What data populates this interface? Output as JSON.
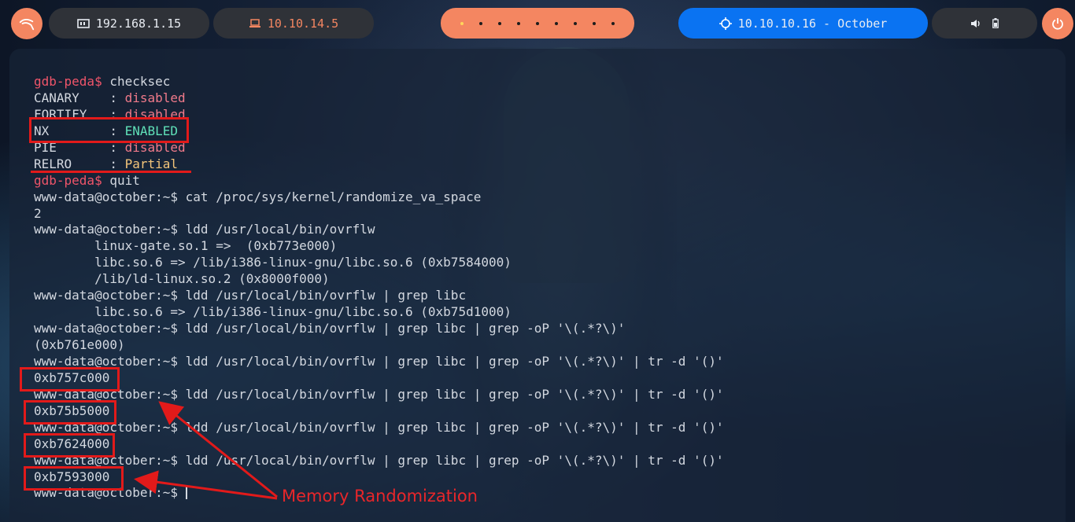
{
  "topbar": {
    "local_ip": "192.168.1.15",
    "vpn_ip": "10.10.14.5",
    "target": "10.10.10.16 - October",
    "workspace_count": 9,
    "active_workspace": 0
  },
  "terminal": {
    "lines": [
      [
        {
          "t": "gdb-peda$ ",
          "c": "pr-red"
        },
        {
          "t": "checksec"
        }
      ],
      [
        {
          "t": "CANARY    : "
        },
        {
          "t": "disabled",
          "c": "val-red"
        }
      ],
      [
        {
          "t": "FORTIFY   : "
        },
        {
          "t": "disabled",
          "c": "val-red"
        }
      ],
      [
        {
          "t": "NX        : "
        },
        {
          "t": "ENABLED",
          "c": "val-green"
        }
      ],
      [
        {
          "t": "PIE       : "
        },
        {
          "t": "disabled",
          "c": "val-red"
        }
      ],
      [
        {
          "t": "RELRO     : "
        },
        {
          "t": "Partial",
          "c": "val-yellow"
        }
      ],
      [
        {
          "t": "gdb-peda$ ",
          "c": "pr-red"
        },
        {
          "t": "quit"
        }
      ],
      [
        {
          "t": "www-data@october:~$ cat /proc/sys/kernel/randomize_va_space"
        }
      ],
      [
        {
          "t": "2"
        }
      ],
      [
        {
          "t": "www-data@october:~$ ldd /usr/local/bin/ovrflw"
        }
      ],
      [
        {
          "t": "        linux-gate.so.1 =>  (0xb773e000)"
        }
      ],
      [
        {
          "t": "        libc.so.6 => /lib/i386-linux-gnu/libc.so.6 (0xb7584000)"
        }
      ],
      [
        {
          "t": "        /lib/ld-linux.so.2 (0x8000f000)"
        }
      ],
      [
        {
          "t": "www-data@october:~$ ldd /usr/local/bin/ovrflw | grep libc"
        }
      ],
      [
        {
          "t": "        libc.so.6 => /lib/i386-linux-gnu/libc.so.6 (0xb75d1000)"
        }
      ],
      [
        {
          "t": "www-data@october:~$ ldd /usr/local/bin/ovrflw | grep libc | grep -oP '\\(.*?\\)'"
        }
      ],
      [
        {
          "t": "(0xb761e000)"
        }
      ],
      [
        {
          "t": "www-data@october:~$ ldd /usr/local/bin/ovrflw | grep libc | grep -oP '\\(.*?\\)' | tr -d '()'"
        }
      ],
      [
        {
          "t": "0xb757c000"
        }
      ],
      [
        {
          "t": "www-data@october:~$ ldd /usr/local/bin/ovrflw | grep libc | grep -oP '\\(.*?\\)' | tr -d '()'"
        }
      ],
      [
        {
          "t": "0xb75b5000"
        }
      ],
      [
        {
          "t": "www-data@october:~$ ldd /usr/local/bin/ovrflw | grep libc | grep -oP '\\(.*?\\)' | tr -d '()'"
        }
      ],
      [
        {
          "t": "0xb7624000"
        }
      ],
      [
        {
          "t": "www-data@october:~$ ldd /usr/local/bin/ovrflw | grep libc | grep -oP '\\(.*?\\)' | tr -d '()'"
        }
      ],
      [
        {
          "t": "0xb7593000"
        }
      ],
      [
        {
          "t": "www-data@october:~$ "
        }
      ]
    ]
  },
  "annotation": {
    "label": "Memory Randomization",
    "color": "#e21a1a"
  },
  "colors": {
    "accent_orange": "#f48661",
    "accent_blue": "#0a73f2",
    "prompt_red": "#f0556a",
    "enabled_green": "#5fe0b8"
  }
}
